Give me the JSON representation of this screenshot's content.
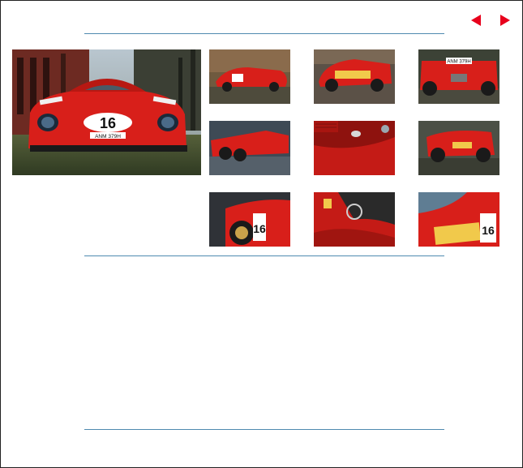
{
  "nav": {
    "prev_icon": "left-arrow-icon",
    "next_icon": "right-arrow-icon",
    "arrow_color": "#e8001c"
  },
  "main_photo": {
    "plate_text": "ANM 379H",
    "race_number": "16",
    "subject": "red race car front view"
  },
  "colors": {
    "rule": "#4f8ab0",
    "car_red": "#d81f1a",
    "frame": "#222222"
  },
  "thumbnails": [
    {
      "id": 1,
      "number": "16",
      "subject": "side view"
    },
    {
      "id": 2,
      "subject": "rear three-quarter view"
    },
    {
      "id": 3,
      "plate_text": "ANM 379H",
      "subject": "rear view"
    },
    {
      "id": 4,
      "subject": "side rear view"
    },
    {
      "id": 5,
      "subject": "bodywork close-up"
    },
    {
      "id": 6,
      "subject": "rear three-quarter view"
    },
    {
      "id": 7,
      "number": "16",
      "subject": "wheel and number close-up"
    },
    {
      "id": 8,
      "subject": "cockpit close-up"
    },
    {
      "id": 9,
      "number": "16",
      "subject": "side detail close-up"
    }
  ]
}
